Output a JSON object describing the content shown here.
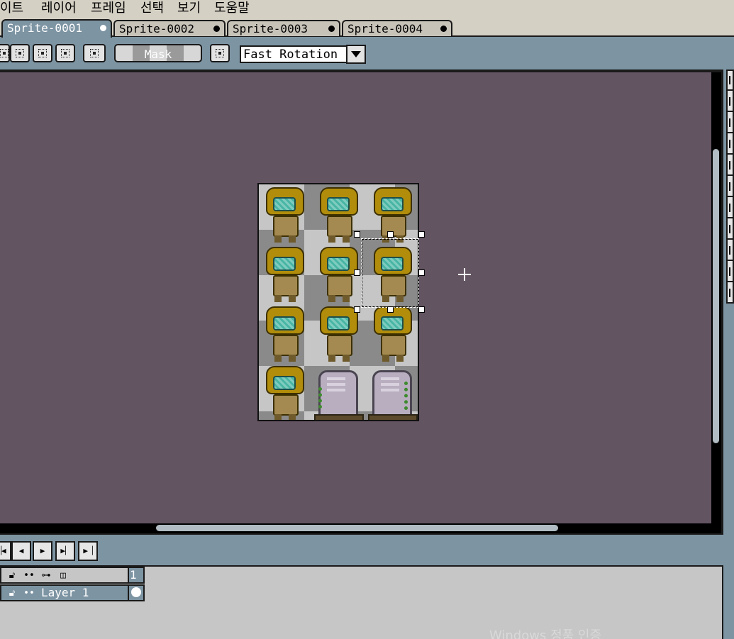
{
  "menu": {
    "items": [
      "이트",
      "레이어",
      "프레임",
      "선택",
      "보기",
      "도움말"
    ]
  },
  "tabs": [
    {
      "label": "Sprite-0001",
      "active": true
    },
    {
      "label": "Sprite-0002",
      "active": false
    },
    {
      "label": "Sprite-0003",
      "active": false
    },
    {
      "label": "Sprite-0004",
      "active": false
    }
  ],
  "toolbar": {
    "mask_label": "Mask",
    "rotation_select": "Fast Rotation"
  },
  "layers": {
    "frame_header": "1",
    "rows": [
      {
        "name": "Layer 1"
      }
    ]
  },
  "playback": {
    "buttons": [
      "first-frame",
      "previous-frame",
      "play",
      "next-frame",
      "last-frame"
    ]
  },
  "watermark": "Windows 정품 인증",
  "colors": {
    "canvas_bg": "#635462",
    "ui_bg": "#7d94a3",
    "menubar": "#d5d0c4",
    "selection": "#ffffff"
  }
}
